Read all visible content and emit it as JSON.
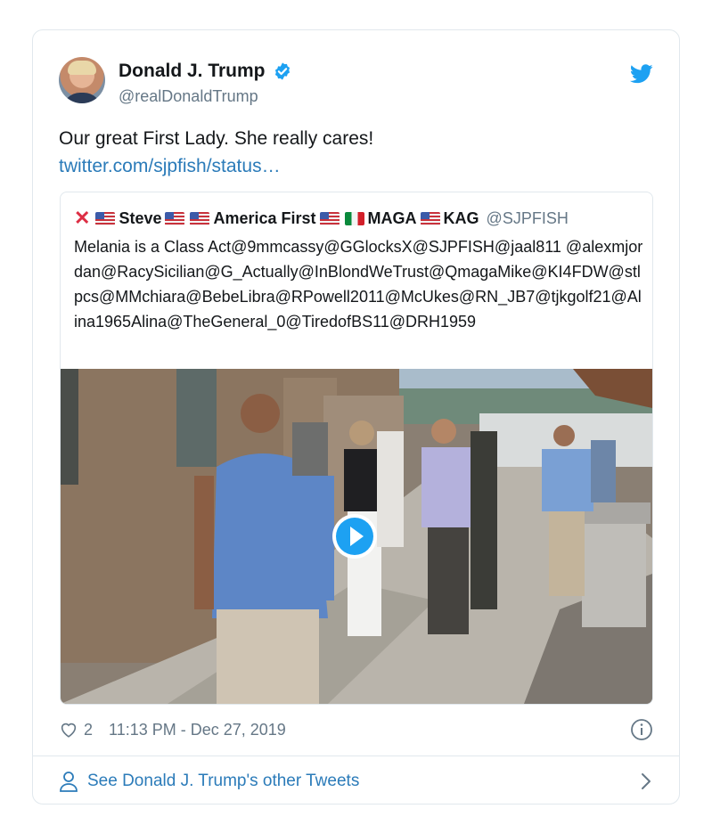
{
  "author": {
    "name": "Donald J. Trump",
    "handle": "@realDonaldTrump",
    "verified": true,
    "icons": {
      "avatar": "profile-photo",
      "verified": "verified-badge-icon",
      "brand": "twitter-bird-icon"
    }
  },
  "tweet": {
    "text": "Our great First Lady. She really cares!",
    "link": "twitter.com/sjpfish/status…"
  },
  "quote": {
    "name_parts": {
      "p1": "Steve",
      "p2": "America First",
      "p3": "MAGA",
      "p4": "KAG"
    },
    "handle": "@SJPFISH",
    "text": "Melania is a Class Act@9mmcassy@GGlocksX@SJPFISH@jaal811 @alexmjordan@RacySicilian@G_Actually@InBlondWeTrust@QmagaMike@KI4FDW@stlpcs@MMchiara@BebeLibra@RPowell2011@McUkes@RN_JB7@tjkgolf21@Alina1965Alina@TheGeneral_0@TiredofBS11@DRH1959",
    "media": {
      "type": "video",
      "icon": "play-icon"
    }
  },
  "meta": {
    "likes": "2",
    "timestamp": "11:13 PM - Dec 27, 2019"
  },
  "footer": {
    "other_tweets": "See Donald J. Trump's other Tweets"
  },
  "colors": {
    "link": "#2b7bb9",
    "twitter_blue": "#1da1f2",
    "muted": "#657786",
    "border": "#e1e8ed"
  }
}
